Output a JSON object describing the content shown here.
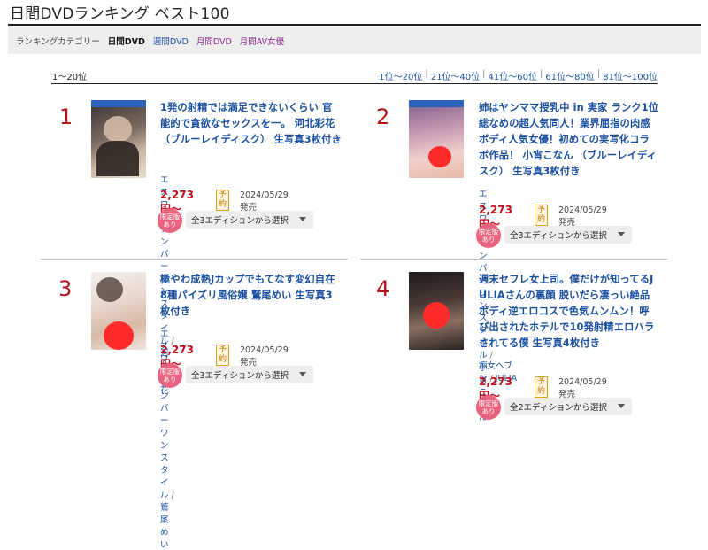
{
  "page": {
    "title": "日間DVDランキング ベスト100"
  },
  "categories": {
    "label": "ランキングカテゴリー",
    "items": [
      {
        "label": "日間DVD",
        "state": "current"
      },
      {
        "label": "週間DVD",
        "state": "link"
      },
      {
        "label": "月間DVD",
        "state": "visited"
      },
      {
        "label": "月間AV女優",
        "state": "visited"
      }
    ]
  },
  "ranking": {
    "range_label": "1～20位",
    "pager": [
      "1位～20位",
      "21位～40位",
      "41位～60位",
      "61位～80位",
      "81位～100位"
    ],
    "pager_separator": "|"
  },
  "colors": {
    "accent_blue": "#1a4fa0",
    "rank_red": "#b5121b",
    "price_red": "#c0101b",
    "limited_pink": "#e8637f",
    "visited_purple": "#8b2a8b"
  },
  "items": [
    {
      "rank": "1",
      "title_lines": [
        "1発の射精では満足できないくらい 官",
        "能的で貪欲なセックスを一。 河北彩花",
        "（ブルーレイディスク） 生写真3枚付き"
      ],
      "maker": "エスワン ナンバーワンスタイル",
      "actress": "河北彩花",
      "price": "2,273円～",
      "badge": "予約",
      "release": "2024/05/29発売",
      "limited": [
        "限定版",
        "あり"
      ],
      "edition": "全3エディションから選択"
    },
    {
      "rank": "2",
      "title_lines": [
        "姉はヤンママ授乳中 in 実家 ランク1位",
        "総なめの超人気同人！業界屈指の肉感",
        "ボディ人気女優！初めての実写化コラ",
        "ボ作品！ 小宵こなん （ブルーレイディ",
        "スク） 生写真3枚付き"
      ],
      "maker": "エスワン ナンバーワンスタイル",
      "actress": "小宵こなん",
      "price": "2,273円～",
      "badge": "予約",
      "release": "2024/05/29発売",
      "limited": [
        "限定版",
        "あり"
      ],
      "edition": "全3エディションから選択"
    },
    {
      "rank": "3",
      "title_lines": [
        "極やわ成熟Jカップでもてなす変幻自在",
        "8種パイズリ風俗嬢 鷲尾めい 生写真3",
        "枚付き"
      ],
      "maker": "エスワン ナンバーワンスタイル",
      "actress": "鷲尾めい",
      "price": "2,273円～",
      "badge": "予約",
      "release": "2024/05/29発売",
      "limited": [
        "限定版",
        "あり"
      ],
      "edition": "全3エディションから選択"
    },
    {
      "rank": "4",
      "title_lines": [
        "週末セフレ女上司。僕だけが知ってるJ",
        "ULIAさんの裏顔 脱いだら凄っい絶品",
        "ボディ逆エロコスで色気ムンムン！呼",
        "び出されたホテルで10発射精エロハラ",
        "されてる僕 生写真4枚付き"
      ],
      "maker": "痴女ヘブン",
      "actress": "JULIA",
      "price": "2,273円～",
      "badge": "予約",
      "release": "2024/05/29発売",
      "limited": [
        "限定版",
        "あり"
      ],
      "edition": "全2エディションから選択"
    }
  ]
}
